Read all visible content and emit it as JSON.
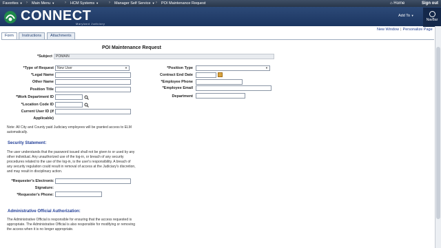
{
  "menubar": {
    "favorites": "Favorites",
    "main_menu": "Main Menu",
    "hcm": "HCM Systems",
    "mss": "Manager Self Service",
    "current": "POI Maintenance Request"
  },
  "header": {
    "logo": "CONNECT",
    "logo_sub": "Maryland Judiciary",
    "home": "Home",
    "signout": "Sign out",
    "add_to": "Add To",
    "navbar": "NavBar"
  },
  "tabs": [
    "Form",
    "Instructions",
    "Attachments"
  ],
  "top_links": {
    "new_window": "New Window",
    "personalize": "Personalize Page"
  },
  "title": "POI Maintenance Request",
  "form": {
    "subject_label": "*Subject",
    "subject_value": "POMAIN",
    "type_of_request_label": "*Type of Request",
    "type_of_request_value": "New User",
    "legal_name_label": "*Legal Name",
    "other_name_label": "Other Name",
    "position_title_label": "Position Title",
    "work_dept_label": "*Work Department ID",
    "location_code_label": "*Location Code ID",
    "current_user_label_1": "Current User ID (if",
    "current_user_label_2": "Applicable)",
    "position_type_label": "*Position Type",
    "contract_end_label": "Contract End Date",
    "employee_phone_label": "*Employee Phone",
    "employee_email_label": "*Employee Email",
    "department_label": "Department",
    "note": "Note: All City and County paid Judiciary employees will be granted access to ELM automatically.",
    "security_heading": "Security Statement:",
    "security_text": "The user understands that the password issued shall not be given to or used by any other individual. Any unauthorized use of the log-in, or breach of any security procedures related to the use of the log-in, is the user's responsibility. A breach of any security regulation could result in removal of access at the Judiciary's discretion, and may result in disciplinary action.",
    "req_sig_label_1": "*Requester's Electronic",
    "req_sig_label_2": "Signature:",
    "req_phone_label": "*Requester's Phone:",
    "admin_heading": "Administrative Official Authorization:",
    "admin_text": "The Administrative Official is responsible for ensuring that the access requested is appropriate. The Administrative Official is also responsible for modifying or removing the access when it is no longer appropriate."
  }
}
